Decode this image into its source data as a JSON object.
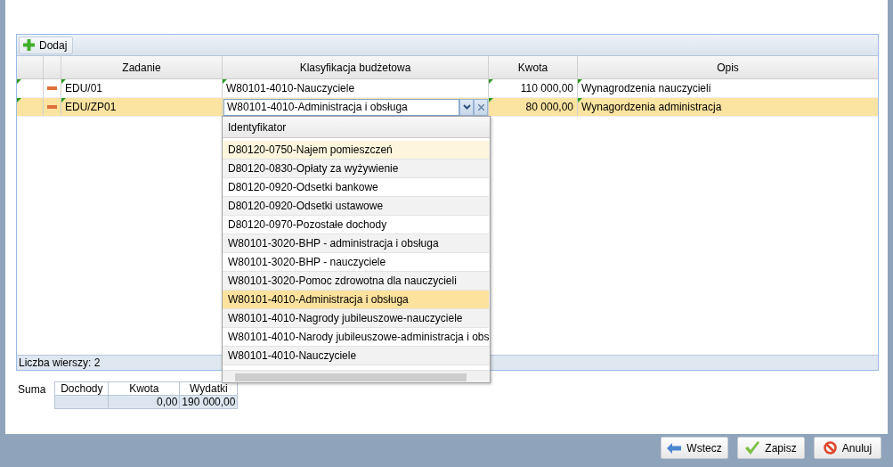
{
  "toolbar": {
    "add_button": "Dodaj"
  },
  "grid": {
    "columns": [
      "Zadanie",
      "Klasyfikacja budżetowa",
      "Kwota",
      "Opis"
    ],
    "rows": [
      {
        "zadanie": "EDU/01",
        "klasyfikacja": "W80101-4010-Nauczyciele",
        "kwota": "110 000,00",
        "opis": "Wynagrodzenia nauczycieli",
        "selected": false,
        "editing": false
      },
      {
        "zadanie": "EDU/ZP01",
        "klasyfikacja": "W80101-4010-Administracja i obsługa",
        "kwota": "80 000,00",
        "opis": "Wynagordzenia administracja",
        "selected": true,
        "editing": true
      }
    ],
    "footer": "Liczba wierszy: 2"
  },
  "dropdown": {
    "header": "Identyfikator",
    "items": [
      {
        "label": "D80120-0750-Najem pomieszczeń",
        "selected": false,
        "hovered": true
      },
      {
        "label": "D80120-0830-Opłaty za wyżywienie",
        "selected": false,
        "hovered": false
      },
      {
        "label": "D80120-0920-Odsetki bankowe",
        "selected": false,
        "hovered": false
      },
      {
        "label": "D80120-0920-Odsetki ustawowe",
        "selected": false,
        "hovered": false
      },
      {
        "label": "D80120-0970-Pozostałe dochody",
        "selected": false,
        "hovered": false
      },
      {
        "label": "W80101-3020-BHP - administracja i obsługa",
        "selected": false,
        "hovered": false
      },
      {
        "label": "W80101-3020-BHP - nauczyciele",
        "selected": false,
        "hovered": false
      },
      {
        "label": "W80101-3020-Pomoc zdrowotna dla nauczycieli",
        "selected": false,
        "hovered": false
      },
      {
        "label": "W80101-4010-Administracja i obsługa",
        "selected": true,
        "hovered": false
      },
      {
        "label": "W80101-4010-Nagrody jubileuszowe-nauczyciele",
        "selected": false,
        "hovered": false
      },
      {
        "label": "W80101-4010-Narody jubileuszowe-administracja i obs",
        "selected": false,
        "hovered": false
      },
      {
        "label": "W80101-4010-Nauczyciele",
        "selected": false,
        "hovered": false
      }
    ]
  },
  "summary": {
    "label": "Suma",
    "columns": [
      {
        "header": "Dochody"
      },
      {
        "header": "Kwota",
        "value": "0,00"
      },
      {
        "header": "Wydatki",
        "value": "190 000,00"
      }
    ]
  },
  "buttons": [
    {
      "kind": "back",
      "label": "Wstecz"
    },
    {
      "kind": "save",
      "label": "Zapisz"
    },
    {
      "kind": "cancel",
      "label": "Anuluj"
    }
  ]
}
